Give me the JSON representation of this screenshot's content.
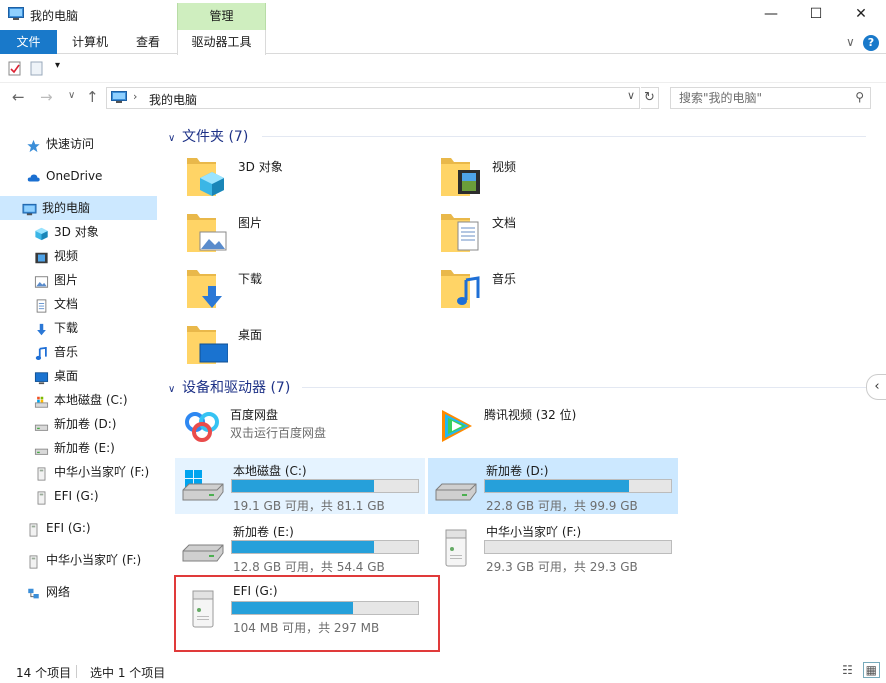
{
  "window": {
    "title": "我的电脑",
    "manage_tab": "管理",
    "min_glyph": "—",
    "max_glyph": "☐",
    "close_glyph": "✕"
  },
  "ribbon": {
    "tabs": [
      "文件",
      "计算机",
      "查看",
      "驱动器工具"
    ],
    "collapse_glyph": "∨",
    "help_glyph": "?"
  },
  "address": {
    "path": "我的电脑",
    "search_placeholder": "搜索\"我的电脑\""
  },
  "nav": {
    "items": [
      {
        "label": "快速访问",
        "icon": "star-icon"
      },
      {
        "label": "OneDrive",
        "icon": "cloud-icon"
      },
      {
        "label": "我的电脑",
        "icon": "computer-icon"
      },
      {
        "label": "3D 对象",
        "icon": "cube-icon"
      },
      {
        "label": "视频",
        "icon": "video-icon"
      },
      {
        "label": "图片",
        "icon": "picture-icon"
      },
      {
        "label": "文档",
        "icon": "document-icon"
      },
      {
        "label": "下载",
        "icon": "download-icon"
      },
      {
        "label": "音乐",
        "icon": "music-icon"
      },
      {
        "label": "桌面",
        "icon": "desktop-icon"
      },
      {
        "label": "本地磁盘 (C:)",
        "icon": "drive-c-icon"
      },
      {
        "label": "新加卷 (D:)",
        "icon": "drive-icon"
      },
      {
        "label": "新加卷 (E:)",
        "icon": "drive-icon"
      },
      {
        "label": "中华小当家吖 (F:)",
        "icon": "usb-drive-icon"
      },
      {
        "label": "EFI (G:)",
        "icon": "usb-drive-icon"
      },
      {
        "label": "EFI (G:)",
        "icon": "usb-drive-icon"
      },
      {
        "label": "中华小当家吖 (F:)",
        "icon": "usb-drive-icon"
      },
      {
        "label": "网络",
        "icon": "network-icon"
      }
    ]
  },
  "folders": {
    "header": "文件夹 (7)",
    "items": [
      {
        "label": "3D 对象",
        "icon": "cube-folder-icon"
      },
      {
        "label": "视频",
        "icon": "video-folder-icon"
      },
      {
        "label": "图片",
        "icon": "picture-folder-icon"
      },
      {
        "label": "文档",
        "icon": "document-folder-icon"
      },
      {
        "label": "下载",
        "icon": "download-folder-icon"
      },
      {
        "label": "音乐",
        "icon": "music-folder-icon"
      },
      {
        "label": "桌面",
        "icon": "desktop-folder-icon"
      }
    ]
  },
  "devices": {
    "header": "设备和驱动器 (7)",
    "apps": [
      {
        "name": "百度网盘",
        "desc": "双击运行百度网盘",
        "icon": "baidu-netdisk-icon"
      },
      {
        "name": "腾讯视频 (32 位)",
        "desc": "",
        "icon": "tencent-video-icon"
      }
    ],
    "drives": [
      {
        "name": "本地磁盘 (C:)",
        "info": "19.1 GB 可用，共 81.1 GB",
        "used_fraction": 0.764
      },
      {
        "name": "新加卷 (D:)",
        "info": "22.8 GB 可用，共 99.9 GB",
        "used_fraction": 0.772
      },
      {
        "name": "新加卷 (E:)",
        "info": "12.8 GB 可用，共 54.4 GB",
        "used_fraction": 0.765
      },
      {
        "name": "中华小当家吖 (F:)",
        "info": "29.3 GB 可用，共 29.3 GB",
        "used_fraction": 0.0
      },
      {
        "name": "EFI (G:)",
        "info": "104 MB 可用，共 297 MB",
        "used_fraction": 0.65
      }
    ]
  },
  "status": {
    "count": "14 个项目",
    "selected": "选中 1 个项目"
  },
  "colors": {
    "accent": "#1979ca",
    "bar_fill": "#26a0da",
    "selection": "#cce8ff",
    "highlight_box": "#e03a3a",
    "manage_tab": "#cfeebf"
  }
}
